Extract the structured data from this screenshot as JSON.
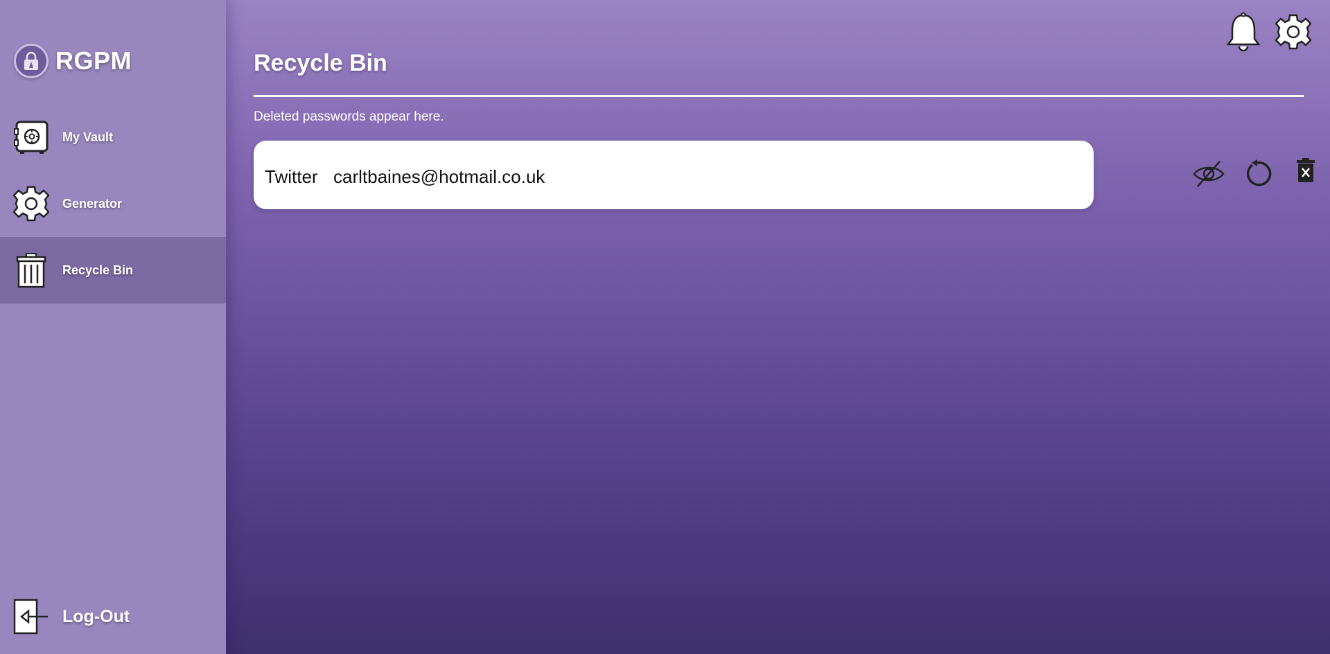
{
  "app": {
    "name": "RGPM"
  },
  "sidebar": {
    "items": [
      {
        "label": "My Vault",
        "icon": "vault-icon"
      },
      {
        "label": "Generator",
        "icon": "gear-icon"
      },
      {
        "label": "Recycle Bin",
        "icon": "trash-icon",
        "active": true
      }
    ],
    "logout_label": "Log-Out"
  },
  "topbar": {
    "icons": [
      "bell-icon",
      "settings-gear-icon"
    ]
  },
  "main": {
    "title": "Recycle Bin",
    "subtitle": "Deleted passwords appear here.",
    "entries": [
      {
        "site": "Twitter",
        "email": "carltbaines@hotmail.co.uk",
        "actions": [
          "eye-slash-icon",
          "restore-icon",
          "delete-forever-icon"
        ]
      }
    ]
  },
  "colors": {
    "sidebar": "#9887be",
    "background_top": "#9a83c4",
    "background_bottom": "#3e2f6e",
    "active_item": "#7a6699",
    "card": "#ffffff"
  }
}
